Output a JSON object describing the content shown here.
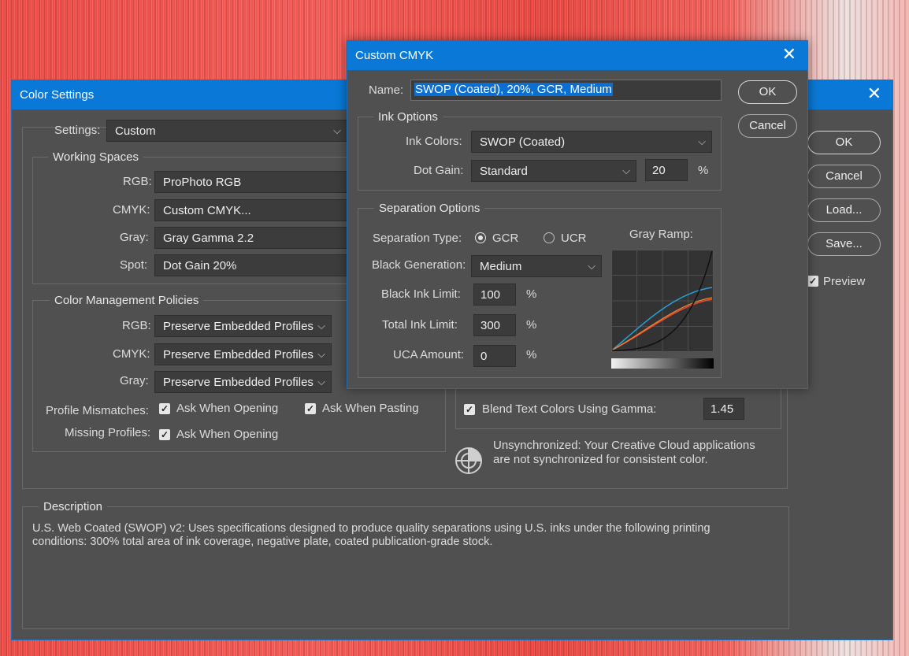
{
  "main": {
    "title": "Color Settings",
    "settings_label": "Settings:",
    "settings_value": "Custom",
    "working_spaces": {
      "title": "Working Spaces",
      "rgb_label": "RGB:",
      "rgb_value": "ProPhoto RGB",
      "cmyk_label": "CMYK:",
      "cmyk_value": "Custom CMYK...",
      "gray_label": "Gray:",
      "gray_value": "Gray Gamma 2.2",
      "spot_label": "Spot:",
      "spot_value": "Dot Gain 20%"
    },
    "policies": {
      "title": "Color Management Policies",
      "rgb_label": "RGB:",
      "rgb_value": "Preserve Embedded Profiles",
      "cmyk_label": "CMYK:",
      "cmyk_value": "Preserve Embedded Profiles",
      "gray_label": "Gray:",
      "gray_value": "Preserve Embedded Profiles",
      "mismatches_label": "Profile Mismatches:",
      "ask_opening": "Ask When Opening",
      "ask_pasting": "Ask When Pasting",
      "missing_label": "Missing Profiles:",
      "ask_opening_missing": "Ask When Opening"
    },
    "blend_text": {
      "label": "Blend Text Colors Using Gamma:",
      "value": "1.45"
    },
    "sync_line1": "Unsynchronized: Your Creative Cloud applications",
    "sync_line2": "are not synchronized for consistent color.",
    "description": {
      "title": "Description",
      "line1": "U.S. Web Coated (SWOP) v2:  Uses specifications designed to produce quality separations using U.S. inks under the following printing",
      "line2": "conditions: 300% total area of ink coverage, negative plate, coated publication-grade stock."
    },
    "buttons": {
      "ok": "OK",
      "cancel": "Cancel",
      "load": "Load...",
      "save": "Save...",
      "preview": "Preview"
    },
    "close_glyph": "✕"
  },
  "cmyk": {
    "title": "Custom CMYK",
    "close_glyph": "✕",
    "name_label": "Name:",
    "name_value": "SWOP (Coated), 20%, GCR, Medium",
    "ok": "OK",
    "cancel": "Cancel",
    "ink_options": {
      "title": "Ink Options",
      "ink_colors_label": "Ink Colors:",
      "ink_colors_value": "SWOP (Coated)",
      "dot_gain_label": "Dot Gain:",
      "dot_gain_value": "Standard",
      "dot_gain_amount": "20",
      "percent": "%"
    },
    "separation": {
      "title": "Separation Options",
      "type_label": "Separation Type:",
      "gcr": "GCR",
      "ucr": "UCR",
      "black_gen_label": "Black Generation:",
      "black_gen_value": "Medium",
      "black_ink_label": "Black Ink Limit:",
      "black_ink_value": "100",
      "total_ink_label": "Total Ink Limit:",
      "total_ink_value": "300",
      "uca_label": "UCA Amount:",
      "uca_value": "0",
      "percent": "%",
      "gray_ramp_label": "Gray Ramp:"
    }
  },
  "colors": {
    "title_bar": "#0a78d6",
    "panel": "#505050",
    "cyan_curve": "#27a0d8",
    "orange_curve": "#f08a2a",
    "red_curve": "#e84b3c"
  }
}
